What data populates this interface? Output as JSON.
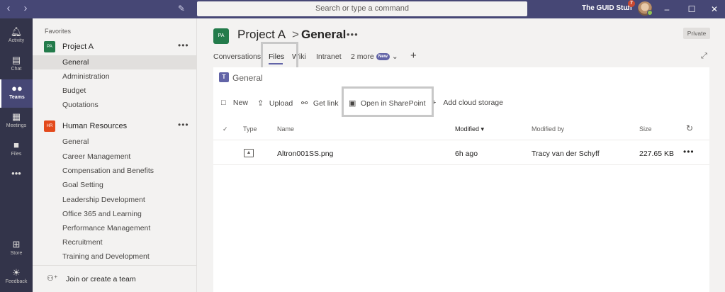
{
  "titlebar": {
    "back_icon": "chevron-left",
    "forward_icon": "chevron-right",
    "compose_icon": "compose",
    "search_placeholder": "Search or type a command",
    "tenant_name": "The GUID Stuff",
    "notification_count": "7",
    "window_controls": [
      "minimize",
      "maximize",
      "close"
    ]
  },
  "appbar": {
    "items": [
      {
        "label": "Activity",
        "icon": "bell"
      },
      {
        "label": "Chat",
        "icon": "chat"
      },
      {
        "label": "Teams",
        "icon": "teams"
      },
      {
        "label": "Meetings",
        "icon": "calendar"
      },
      {
        "label": "Files",
        "icon": "file"
      },
      {
        "label": "",
        "icon": "more"
      },
      {
        "label": "Store",
        "icon": "store"
      },
      {
        "label": "Feedback",
        "icon": "feedback"
      }
    ],
    "active": "Teams"
  },
  "rail": {
    "favorites_label": "Favorites",
    "teams": [
      {
        "initials": "PA",
        "name": "Project A",
        "color": "#237b4b",
        "channels": [
          "General",
          "Administration",
          "Budget",
          "Quotations"
        ]
      },
      {
        "initials": "HR",
        "name": "Human Resources",
        "color": "#e34a1c",
        "channels": [
          "General",
          "Career Management",
          "Compensation and Benefits",
          "Goal Setting",
          "Leadership Development",
          "Office 365 and Learning",
          "Performance Management",
          "Recruitment",
          "Training and Development"
        ]
      }
    ],
    "join_label": "Join or create a team"
  },
  "header": {
    "team_initials": "PA",
    "team_name": "Project A",
    "separator": ">",
    "channel_name": "General",
    "privacy_label": "Private"
  },
  "tabs": {
    "items": [
      "Conversations",
      "Files",
      "Wiki",
      "Intranet"
    ],
    "more_label": "2 more",
    "new_badge": "New",
    "active": "Files"
  },
  "library": {
    "title": "General",
    "commands": {
      "new": "New",
      "upload": "Upload",
      "get_link": "Get link",
      "open_sharepoint": "Open in SharePoint",
      "add_cloud": "Add cloud storage"
    },
    "columns": {
      "type": "Type",
      "name": "Name",
      "modified": "Modified",
      "modified_by": "Modified by",
      "size": "Size"
    },
    "rows": [
      {
        "type": "image",
        "name": "Altron001SS.png",
        "modified": "6h ago",
        "modified_by": "Tracy van der Schyff",
        "size": "227.65 KB"
      }
    ]
  },
  "colors": {
    "titlebar": "#464775",
    "appbar": "#33344a",
    "accent": "#6264a7"
  }
}
